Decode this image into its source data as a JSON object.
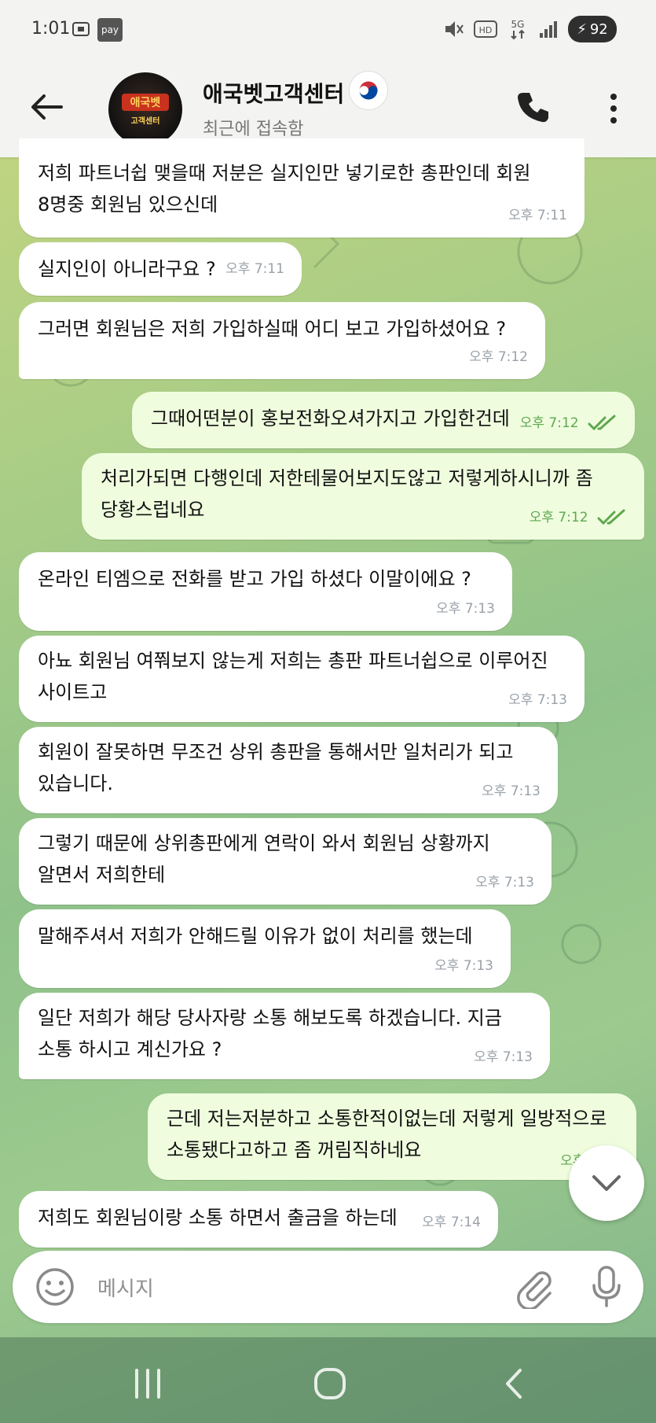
{
  "status_bar": {
    "time": "1:01",
    "pay_label": "pay",
    "battery": "92"
  },
  "header": {
    "title": "애국벳고객센터",
    "subtitle": "최근에 접속함",
    "avatar_text_top": "애국벳",
    "avatar_text_bottom": "고객센터"
  },
  "messages": [
    {
      "dir": "in",
      "text": "저희 파트너쉽 맺을때 저분은 실지인만 넣기로한 총판인데 회원\n8명중 회원님 있으신데",
      "time": "오후 7:11"
    },
    {
      "dir": "in",
      "text": "실지인이 아니라구요 ?",
      "time": "오후 7:11"
    },
    {
      "dir": "in",
      "text": "그러면 회원님은 저희 가입하실때 어디 보고 가입하셨어요 ?",
      "time": "오후 7:12"
    },
    {
      "dir": "out",
      "text": "그때어떤분이 홍보전화오셔가지고 가입한건데",
      "time": "오후 7:12"
    },
    {
      "dir": "out",
      "text": "처리가되면 다행인데 저한테물어보지도않고 저렇게하시니까 좀\n당황스럽네요",
      "time": "오후 7:12"
    },
    {
      "dir": "in",
      "text": "온라인 티엠으로 전화를 받고 가입 하셨다 이말이에요 ?",
      "time": "오후 7:13"
    },
    {
      "dir": "in",
      "text": "아뇨 회원님 여쭤보지 않는게 저희는 총판 파트너쉽으로 이루어진\n사이트고",
      "time": "오후 7:13"
    },
    {
      "dir": "in",
      "text": "회원이 잘못하면 무조건 상위 총판을 통해서만 일처리가 되고\n있습니다.",
      "time": "오후 7:13"
    },
    {
      "dir": "in",
      "text": "그렇기 때문에 상위총판에게 연락이 와서 회원님 상황까지\n알면서 저희한테",
      "time": "오후 7:13"
    },
    {
      "dir": "in",
      "text": "말해주셔서 저희가 안해드릴 이유가 없이 처리를 했는데",
      "time": "오후 7:13"
    },
    {
      "dir": "in",
      "text": "일단 저희가 해당 당사자랑 소통 해보도록 하겠습니다. 지금\n소통 하시고 계신가요 ?",
      "time": "오후 7:13"
    },
    {
      "dir": "out",
      "text": "근데 저는저분하고 소통한적이없는데 저렇게 일방적으로\n소통됐다고하고 좀 꺼림직하네요",
      "time": "오후 7:14"
    },
    {
      "dir": "in",
      "text": "저희도 회원님이랑 소통 하면서 출금을 하는데",
      "time": "오후 7:14"
    }
  ],
  "input": {
    "placeholder": "메시지"
  },
  "colors": {
    "outgoing_bubble": "#effdde",
    "incoming_bubble": "#ffffff",
    "check_color": "#5fa74f"
  }
}
